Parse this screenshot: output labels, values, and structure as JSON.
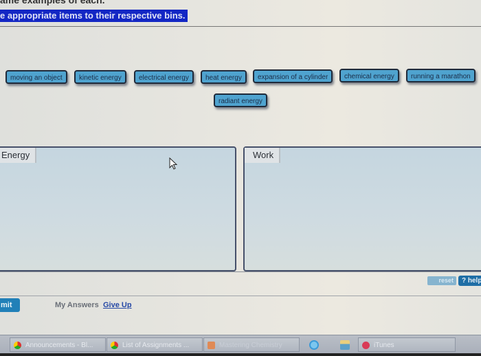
{
  "page": {
    "partial_heading": "ame examples of each.",
    "instruction": "e appropriate items to their respective bins."
  },
  "chips": [
    {
      "label": "moving an object"
    },
    {
      "label": "kinetic energy"
    },
    {
      "label": "electrical energy"
    },
    {
      "label": "heat energy"
    },
    {
      "label": "expansion of a cylinder"
    },
    {
      "label": "chemical energy"
    },
    {
      "label": "running a marathon"
    },
    {
      "label": "radiant energy"
    }
  ],
  "bins": [
    {
      "label": "Energy"
    },
    {
      "label": "Work"
    }
  ],
  "controls": {
    "reset_label": "reset",
    "help_label": "? help",
    "submit_label": "mit",
    "my_answers_label": "My Answers",
    "give_up_label": "Give Up"
  },
  "taskbar": {
    "tasks": [
      {
        "label": "Announcements - Bl...",
        "icon": "chrome-icon"
      },
      {
        "label": "List of Assignments ...",
        "icon": "chrome-icon"
      },
      {
        "label": "Mastering Chemistry",
        "icon": "app-icon"
      },
      {
        "label": "iTunes",
        "icon": "itunes-icon"
      }
    ],
    "pinned": [
      {
        "icon": "internet-explorer-icon"
      },
      {
        "icon": "file-explorer-icon"
      }
    ]
  },
  "colors": {
    "instruction_highlight": "#1327c4",
    "chip_fill": "#4fa3cf",
    "help_button": "#1f6ea6",
    "submit_button": "#2180b8",
    "give_up_link": "#2548a5"
  }
}
